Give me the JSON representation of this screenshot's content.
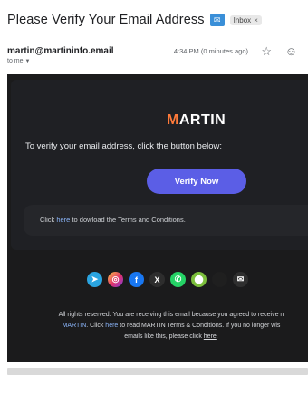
{
  "subject": {
    "title": "Please Verify Your Email Address",
    "emoji": "📧",
    "label": "Inbox",
    "label_close": "×"
  },
  "sender": {
    "address": "martin@martininfo.email",
    "to": "to me",
    "time": "4:34 PM (0 minutes ago)",
    "star": "☆",
    "emoji_react": "☺"
  },
  "email": {
    "brand_first": "M",
    "brand_rest": "ARTIN",
    "intro": "To verify your email address, click the button below:",
    "button_label": "Verify Now",
    "download_before": "Click ",
    "download_link": "here",
    "download_after": " to dowload the Terms and Conditions.",
    "socials": [
      {
        "name": "telegram",
        "glyph": "➤"
      },
      {
        "name": "instagram",
        "glyph": "◎"
      },
      {
        "name": "facebook",
        "glyph": "f"
      },
      {
        "name": "x",
        "glyph": "X"
      },
      {
        "name": "whatsapp",
        "glyph": "✆"
      },
      {
        "name": "android",
        "glyph": "⬤"
      },
      {
        "name": "apple",
        "glyph": ""
      },
      {
        "name": "mail",
        "glyph": "✉"
      }
    ],
    "footer_line1": "All rights reserved. You are receiving this email because you agreed to receive n",
    "footer_brand": "MARTIN",
    "footer_mid1": ". Click ",
    "footer_link1": "here",
    "footer_mid2": " to read MARTIN Terms & Conditions. If you no longer wis",
    "footer_line3": "emails like this, please click ",
    "footer_link2": "here",
    "footer_end": "."
  },
  "colors": {
    "button": "#5b5ee6",
    "email_bg": "#1b1b1c",
    "link": "#8ab4f8",
    "brand_accent": "#ff7a3a"
  }
}
